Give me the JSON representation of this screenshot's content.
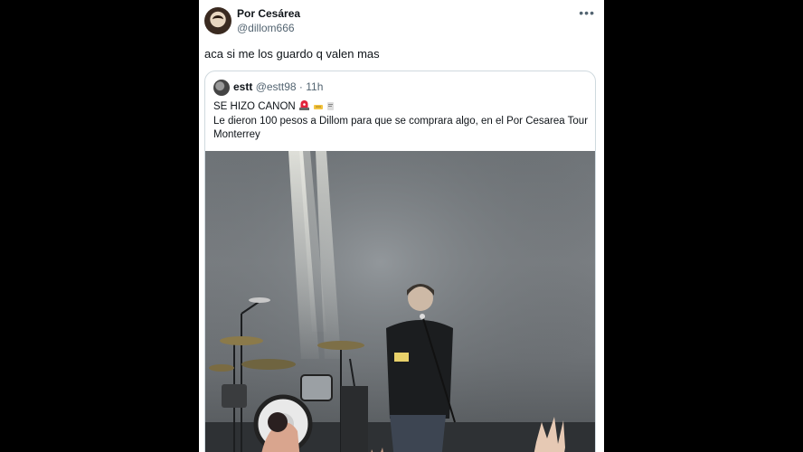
{
  "tweet": {
    "author_name": "Por Cesárea",
    "author_handle": "@dillom666",
    "more_icon": "•••",
    "text": "aca si me los guardo q valen mas"
  },
  "quoted": {
    "author_name": "estt",
    "author_handle": "@estt98",
    "separator": "·",
    "time": "11h",
    "line1": "SE HIZO CANON",
    "line2": "Le dieron 100 pesos a Dillom para que se comprara algo, en el Por Cesarea Tour Monterrey",
    "icons": [
      "siren-emoji",
      "receipt-emoji",
      "dollar-emoji"
    ]
  }
}
